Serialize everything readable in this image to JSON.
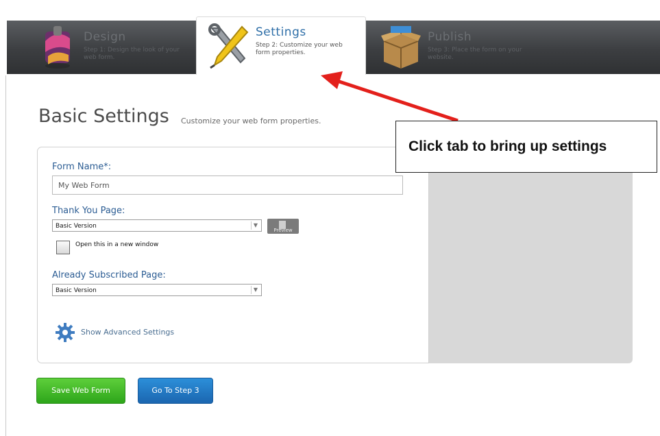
{
  "tabs": [
    {
      "title": "Design",
      "desc": "Step 1: Design the look of your web form."
    },
    {
      "title": "Settings",
      "desc": "Step 2: Customize your web form properties."
    },
    {
      "title": "Publish",
      "desc": "Step 3: Place the form on your website."
    }
  ],
  "page": {
    "title": "Basic Settings",
    "subtitle": "Customize your web form properties."
  },
  "form": {
    "form_name_label": "Form Name*:",
    "form_name_value": "My Web Form",
    "thank_you_label": "Thank You Page:",
    "thank_you_value": "Basic Version",
    "preview_label": "Preview",
    "open_new_window_label": "Open this in a new window",
    "open_new_window_checked": false,
    "already_subscribed_label": "Already Subscribed Page:",
    "already_subscribed_value": "Basic Version",
    "advanced_link": "Show Advanced Settings"
  },
  "buttons": {
    "save": "Save Web Form",
    "next": "Go To Step 3"
  },
  "callout": {
    "text": "Click tab to bring up settings"
  },
  "colors": {
    "accent_blue": "#2f6fa8",
    "save_green": "#3dbb26",
    "step_blue": "#1f78c6",
    "arrow_red": "#e3201b"
  }
}
